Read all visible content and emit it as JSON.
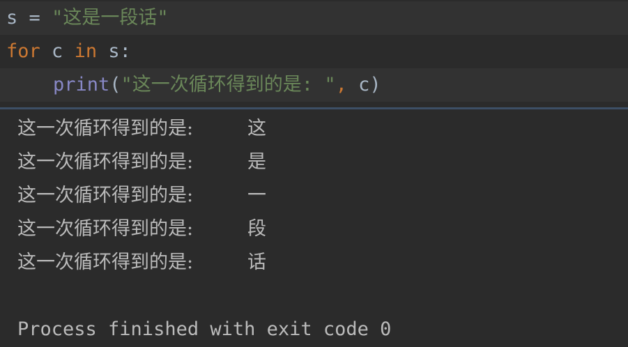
{
  "editor": {
    "line1": {
      "var": "s",
      "op": "=",
      "string": "\"这是一段话\""
    },
    "line2": {
      "kw_for": "for",
      "var": "c",
      "kw_in": "in",
      "iter": "s:"
    },
    "line3": {
      "fn": "print",
      "open": "(",
      "string": "\"这一次循环得到的是: \"",
      "comma": ",",
      "arg": "c",
      "close": ")"
    }
  },
  "console": {
    "output": [
      {
        "prefix": "这一次循环得到的是:",
        "char": "这"
      },
      {
        "prefix": "这一次循环得到的是:",
        "char": "是"
      },
      {
        "prefix": "这一次循环得到的是:",
        "char": "一"
      },
      {
        "prefix": "这一次循环得到的是:",
        "char": "段"
      },
      {
        "prefix": "这一次循环得到的是:",
        "char": "话"
      }
    ],
    "exit_message": "Process finished with exit code 0"
  },
  "colors": {
    "background": "#2b2b2b",
    "current_line": "#323232",
    "keyword": "#cc7832",
    "string": "#6a8759",
    "builtin": "#8888c6",
    "text": "#a9b7c6",
    "console_text": "#bbbbbb"
  }
}
